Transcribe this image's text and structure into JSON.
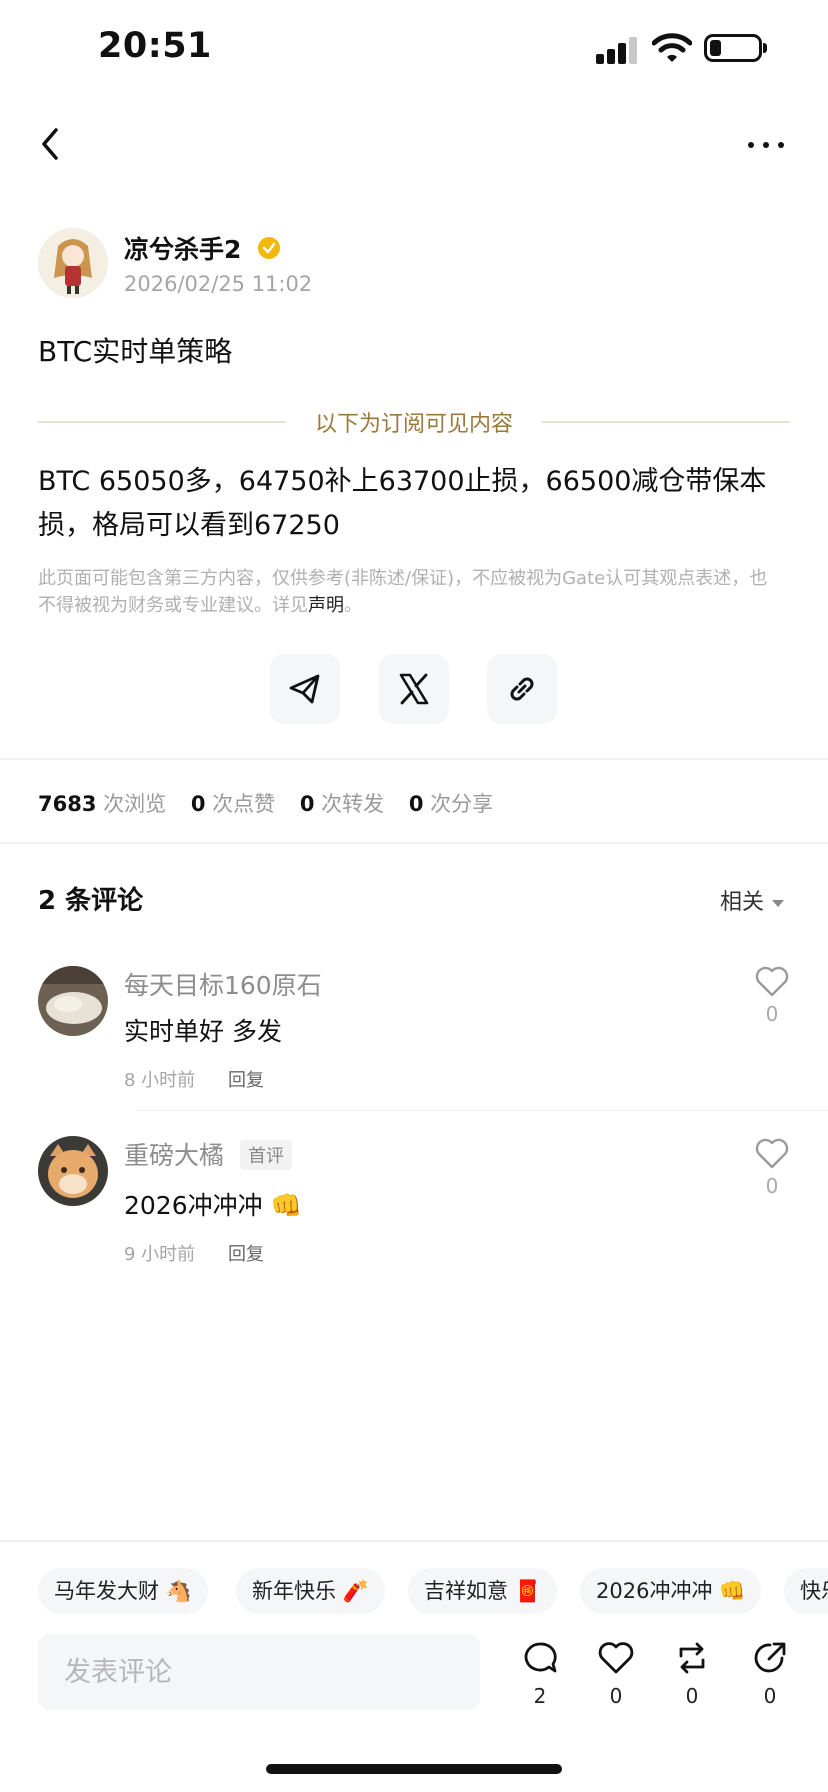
{
  "status_bar": {
    "time": "20:51",
    "battery_level": 0.2
  },
  "nav": {
    "back_icon": "chevron-left-icon",
    "more_icon": "more-icon"
  },
  "post": {
    "author": "凉兮杀手2",
    "timestamp": "2026/02/25 11:02",
    "title": "BTC实时单策略",
    "subscriber_divider": "以下为订阅可见内容",
    "body": "BTC 65050多，64750补上63700止损，66500减仓带保本损，格局可以看到67250",
    "disclaimer_text": "此页面可能包含第三方内容，仅供参考(非陈述/保证)，不应被视为Gate认可其观点表述，也不得被视为财务或专业建议。详见",
    "disclaimer_link": "声明",
    "disclaimer_end": "。"
  },
  "share": [
    {
      "icon": "telegram-icon"
    },
    {
      "icon": "x-icon"
    },
    {
      "icon": "link-icon"
    }
  ],
  "stats": {
    "views": "7683",
    "views_label": "次浏览",
    "likes": "0",
    "likes_label": "次点赞",
    "reposts": "0",
    "reposts_label": "次转发",
    "shares": "0",
    "shares_label": "次分享"
  },
  "comments": {
    "title": "2 条评论",
    "sort_label": "相关",
    "items": [
      {
        "name": "每天目标160原石",
        "text": "实时单好 多发",
        "time": "8 小时前",
        "reply": "回复",
        "likes": "0"
      },
      {
        "name": "重磅大橘",
        "badge": "首评",
        "text": "2026冲冲冲 👊",
        "time": "9 小时前",
        "reply": "回复",
        "likes": "0"
      }
    ]
  },
  "chips": [
    "马年发大财 🐴",
    "新年快乐 🧨",
    "吉祥如意 🧧",
    "2026冲冲冲 👊",
    "快乐"
  ],
  "bottom_bar": {
    "input_placeholder": "发表评论",
    "comment_count": "2",
    "like_count": "0",
    "repost_count": "0",
    "share_count": "0"
  },
  "colors": {
    "gold_divider": "#9a7a3a",
    "verified_badge": "#f0b90b"
  }
}
